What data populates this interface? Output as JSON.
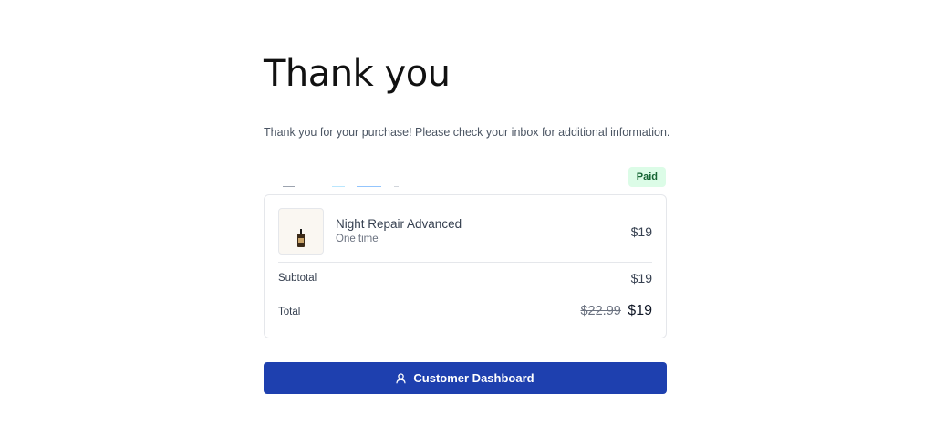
{
  "page": {
    "title": "Thank you",
    "message": "Thank you for your purchase! Please check your inbox for additional information."
  },
  "order": {
    "status_badge": "Paid",
    "item": {
      "name": "Night Repair Advanced",
      "frequency": "One time",
      "price": "$19",
      "thumbnail_icon": "serum-bottle-icon"
    },
    "subtotal_label": "Subtotal",
    "subtotal_value": "$19",
    "total_label": "Total",
    "total_original": "$22.99",
    "total_final": "$19"
  },
  "actions": {
    "dashboard_label": "Customer Dashboard",
    "dashboard_icon": "user-icon"
  },
  "colors": {
    "primary": "#1e40af",
    "badge_bg": "#dcfce7",
    "badge_text": "#166534"
  }
}
